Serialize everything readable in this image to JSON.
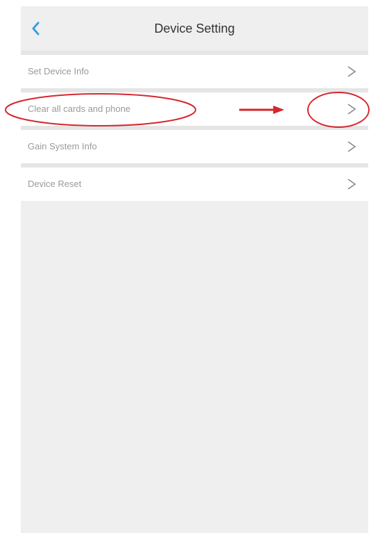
{
  "header": {
    "title": "Device Setting",
    "back_icon": "chevron-left-icon",
    "accent_color": "#3aa0e0"
  },
  "menu": {
    "items": [
      {
        "label": "Set Device Info",
        "icon": "chevron-right-icon"
      },
      {
        "label": "Clear all cards and phone",
        "icon": "chevron-right-icon",
        "highlighted": true
      },
      {
        "label": "Gain System Info",
        "icon": "chevron-right-icon"
      },
      {
        "label": "Device Reset",
        "icon": "chevron-right-icon"
      }
    ]
  },
  "annotation": {
    "color": "#d7262d",
    "shapes": [
      "ellipse-around-label",
      "arrow-right",
      "circle-around-chevron"
    ]
  }
}
